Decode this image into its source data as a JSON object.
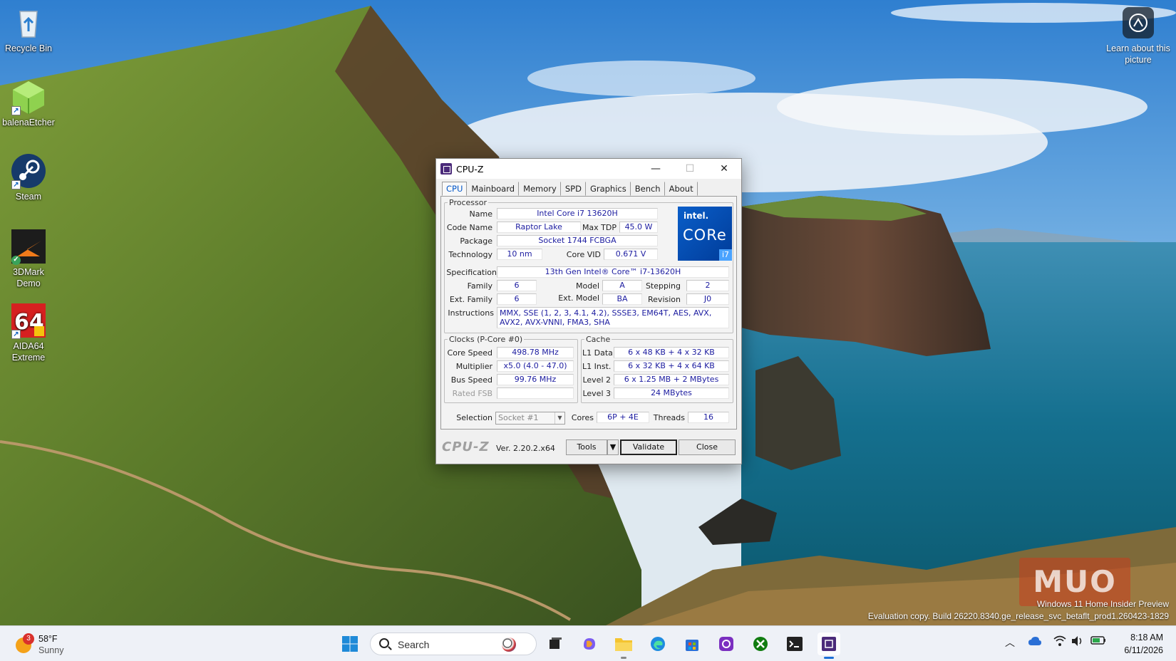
{
  "desktop": {
    "icons": [
      {
        "label": "Recycle Bin"
      },
      {
        "label": "balenaEtcher"
      },
      {
        "label": "Steam"
      },
      {
        "label": "3DMark\nDemo"
      },
      {
        "label": "AIDA64\nExtreme"
      }
    ],
    "learn_label": "Learn about this picture",
    "watermark_line1": "Windows 11 Home Insider Preview",
    "watermark_line2": "Evaluation copy. Build 26220.8340.ge_release_svc_betaflt_prod1.260423-1829",
    "site_logo": "MUO"
  },
  "window": {
    "title": "CPU-Z",
    "controls": {
      "minimize": "—",
      "maximize": "☐",
      "close": "✕"
    },
    "tabs": [
      "CPU",
      "Mainboard",
      "Memory",
      "SPD",
      "Graphics",
      "Bench",
      "About"
    ],
    "active_tab": "CPU",
    "processor": {
      "legend": "Processor",
      "name_label": "Name",
      "name": "Intel Core i7 13620H",
      "codename_label": "Code Name",
      "codename": "Raptor Lake",
      "maxtdp_label": "Max TDP",
      "maxtdp": "45.0 W",
      "package_label": "Package",
      "package": "Socket 1744 FCBGA",
      "technology_label": "Technology",
      "technology": "10 nm",
      "corevid_label": "Core VID",
      "corevid": "0.671 V",
      "spec_label": "Specification",
      "spec": "13th Gen Intel® Core™ i7-13620H",
      "family_label": "Family",
      "family": "6",
      "model_label": "Model",
      "model": "A",
      "stepping_label": "Stepping",
      "stepping": "2",
      "extfamily_label": "Ext. Family",
      "extfamily": "6",
      "extmodel_label": "Ext. Model",
      "extmodel": "BA",
      "revision_label": "Revision",
      "revision": "J0",
      "instructions_label": "Instructions",
      "instructions": "MMX, SSE (1, 2, 3, 4.1, 4.2), SSSE3, EM64T, AES, AVX, AVX2, AVX-VNNI, FMA3, SHA",
      "logo_brand": "intel.",
      "logo_core": "CORe",
      "logo_tier": "i7"
    },
    "clocks": {
      "legend": "Clocks (P-Core #0)",
      "corespeed_label": "Core Speed",
      "corespeed": "498.78 MHz",
      "multiplier_label": "Multiplier",
      "multiplier": "x5.0 (4.0 - 47.0)",
      "busspeed_label": "Bus Speed",
      "busspeed": "99.76 MHz",
      "ratedfsb_label": "Rated FSB",
      "ratedfsb": ""
    },
    "cache": {
      "legend": "Cache",
      "l1data_label": "L1 Data",
      "l1data": "6 x 48 KB + 4 x 32 KB",
      "l1inst_label": "L1 Inst.",
      "l1inst": "6 x 32 KB + 4 x 64 KB",
      "level2_label": "Level 2",
      "level2": "6 x 1.25 MB + 2 MBytes",
      "level3_label": "Level 3",
      "level3": "24 MBytes"
    },
    "selection_label": "Selection",
    "selection_value": "Socket #1",
    "cores_label": "Cores",
    "cores": "6P + 4E",
    "threads_label": "Threads",
    "threads": "16",
    "brand": "CPU-Z",
    "version": "Ver. 2.20.2.x64",
    "tools_label": "Tools",
    "validate_label": "Validate",
    "close_label": "Close"
  },
  "taskbar": {
    "weather_badge": "3",
    "weather_temp": "58°F",
    "weather_cond": "Sunny",
    "search_placeholder": "Search",
    "time": "8:18 AM",
    "date": "6/11/2026"
  }
}
